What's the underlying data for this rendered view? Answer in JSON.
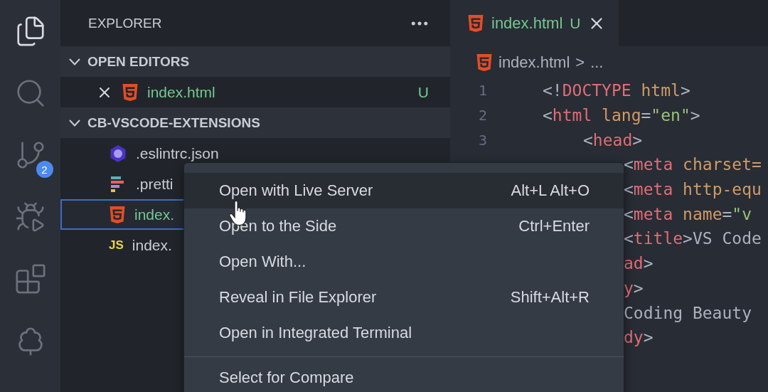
{
  "activity_bar": {
    "items": [
      {
        "kind": "explorer",
        "selected": true
      },
      {
        "kind": "search",
        "selected": false
      },
      {
        "kind": "source-control",
        "selected": false,
        "badge": "2"
      },
      {
        "kind": "run",
        "selected": false
      },
      {
        "kind": "extensions",
        "selected": false
      },
      {
        "kind": "testing",
        "selected": false
      }
    ]
  },
  "sidebar": {
    "title": "EXPLORER",
    "sections": [
      {
        "title": "OPEN EDITORS",
        "expanded": true,
        "items": [
          {
            "name": "index.html",
            "kind": "html",
            "untracked": true,
            "status": "U",
            "selected": false
          }
        ]
      },
      {
        "title": "CB-VSCODE-EXTENSIONS",
        "expanded": true,
        "items": [
          {
            "name": ".eslintrc.json",
            "kind": "eslint",
            "untracked": false,
            "selected": false
          },
          {
            "name": ".pretti",
            "kind": "prettier",
            "untracked": false,
            "selected": false
          },
          {
            "name": "index.",
            "kind": "html",
            "untracked": true,
            "selected": true
          },
          {
            "name": "index.",
            "kind": "js",
            "icon_text": "JS",
            "untracked": false,
            "selected": false
          }
        ]
      }
    ]
  },
  "editor": {
    "tabs": [
      {
        "name": "index.html",
        "kind": "html",
        "status": "U",
        "selected": true
      }
    ],
    "breadcrumb": {
      "file": "index.html",
      "separator": ">",
      "rest": "..."
    },
    "lines": [
      {
        "number": "1",
        "kind": "root",
        "tokens": [
          {
            "kind": "punct",
            "text": "<!"
          },
          {
            "kind": "keyword",
            "text": "DOCTYPE"
          },
          {
            "kind": "attr",
            "text": " html"
          },
          {
            "kind": "punct",
            "text": ">"
          }
        ]
      },
      {
        "number": "2",
        "kind": "root",
        "tokens": [
          {
            "kind": "punct",
            "text": "<"
          },
          {
            "kind": "tag",
            "text": "html"
          },
          {
            "kind": "attr",
            "text": " lang"
          },
          {
            "kind": "punct",
            "text": "="
          },
          {
            "kind": "string",
            "text": "\"en\""
          },
          {
            "kind": "punct",
            "text": ">"
          }
        ]
      },
      {
        "number": "3",
        "kind": "child",
        "tokens": [
          {
            "kind": "punct",
            "text": "<"
          },
          {
            "kind": "tag",
            "text": "head"
          },
          {
            "kind": "punct",
            "text": ">"
          }
        ]
      },
      {
        "kind": "grandchild",
        "tokens": [
          {
            "kind": "punct",
            "text": "<"
          },
          {
            "kind": "tag",
            "text": "meta"
          },
          {
            "kind": "attr",
            "text": " charset="
          }
        ]
      },
      {
        "kind": "grandchild",
        "tokens": [
          {
            "kind": "punct",
            "text": "<"
          },
          {
            "kind": "tag",
            "text": "meta"
          },
          {
            "kind": "attr",
            "text": " http-equ"
          }
        ]
      },
      {
        "kind": "grandchild",
        "tokens": [
          {
            "kind": "punct",
            "text": "<"
          },
          {
            "kind": "tag",
            "text": "meta"
          },
          {
            "kind": "attr",
            "text": " name"
          },
          {
            "kind": "punct",
            "text": "="
          },
          {
            "kind": "string",
            "text": "\"v"
          }
        ]
      },
      {
        "kind": "grandchild",
        "tokens": [
          {
            "kind": "punct",
            "text": "<"
          },
          {
            "kind": "tag",
            "text": "title"
          },
          {
            "kind": "punct",
            "text": ">"
          },
          {
            "kind": "text",
            "text": "VS Code"
          }
        ]
      },
      {
        "kind": "grandchild",
        "tokens": [
          {
            "kind": "tag",
            "text": "ad"
          },
          {
            "kind": "punct",
            "text": ">"
          }
        ]
      },
      {
        "kind": "grandchild",
        "tokens": [
          {
            "kind": "tag",
            "text": "y"
          },
          {
            "kind": "punct",
            "text": ">"
          }
        ]
      },
      {
        "kind": "grandchild",
        "tokens": [
          {
            "kind": "text",
            "text": "Coding Beauty"
          }
        ]
      },
      {
        "kind": "grandchild",
        "tokens": [
          {
            "kind": "tag",
            "text": "dy"
          },
          {
            "kind": "punct",
            "text": ">"
          }
        ]
      }
    ]
  },
  "context_menu": {
    "items": [
      {
        "kind": "item",
        "label": "Open with Live Server",
        "shortcut": "Alt+L Alt+O",
        "selected": true
      },
      {
        "kind": "item",
        "label": "Open to the Side",
        "shortcut": "Ctrl+Enter",
        "selected": false
      },
      {
        "kind": "item",
        "label": "Open With...",
        "selected": false
      },
      {
        "kind": "item",
        "label": "Reveal in File Explorer",
        "shortcut": "Shift+Alt+R",
        "selected": false
      },
      {
        "kind": "item",
        "label": "Open in Integrated Terminal",
        "selected": false
      },
      {
        "kind": "separator"
      },
      {
        "kind": "item",
        "label": "Select for Compare",
        "selected": false
      }
    ]
  }
}
